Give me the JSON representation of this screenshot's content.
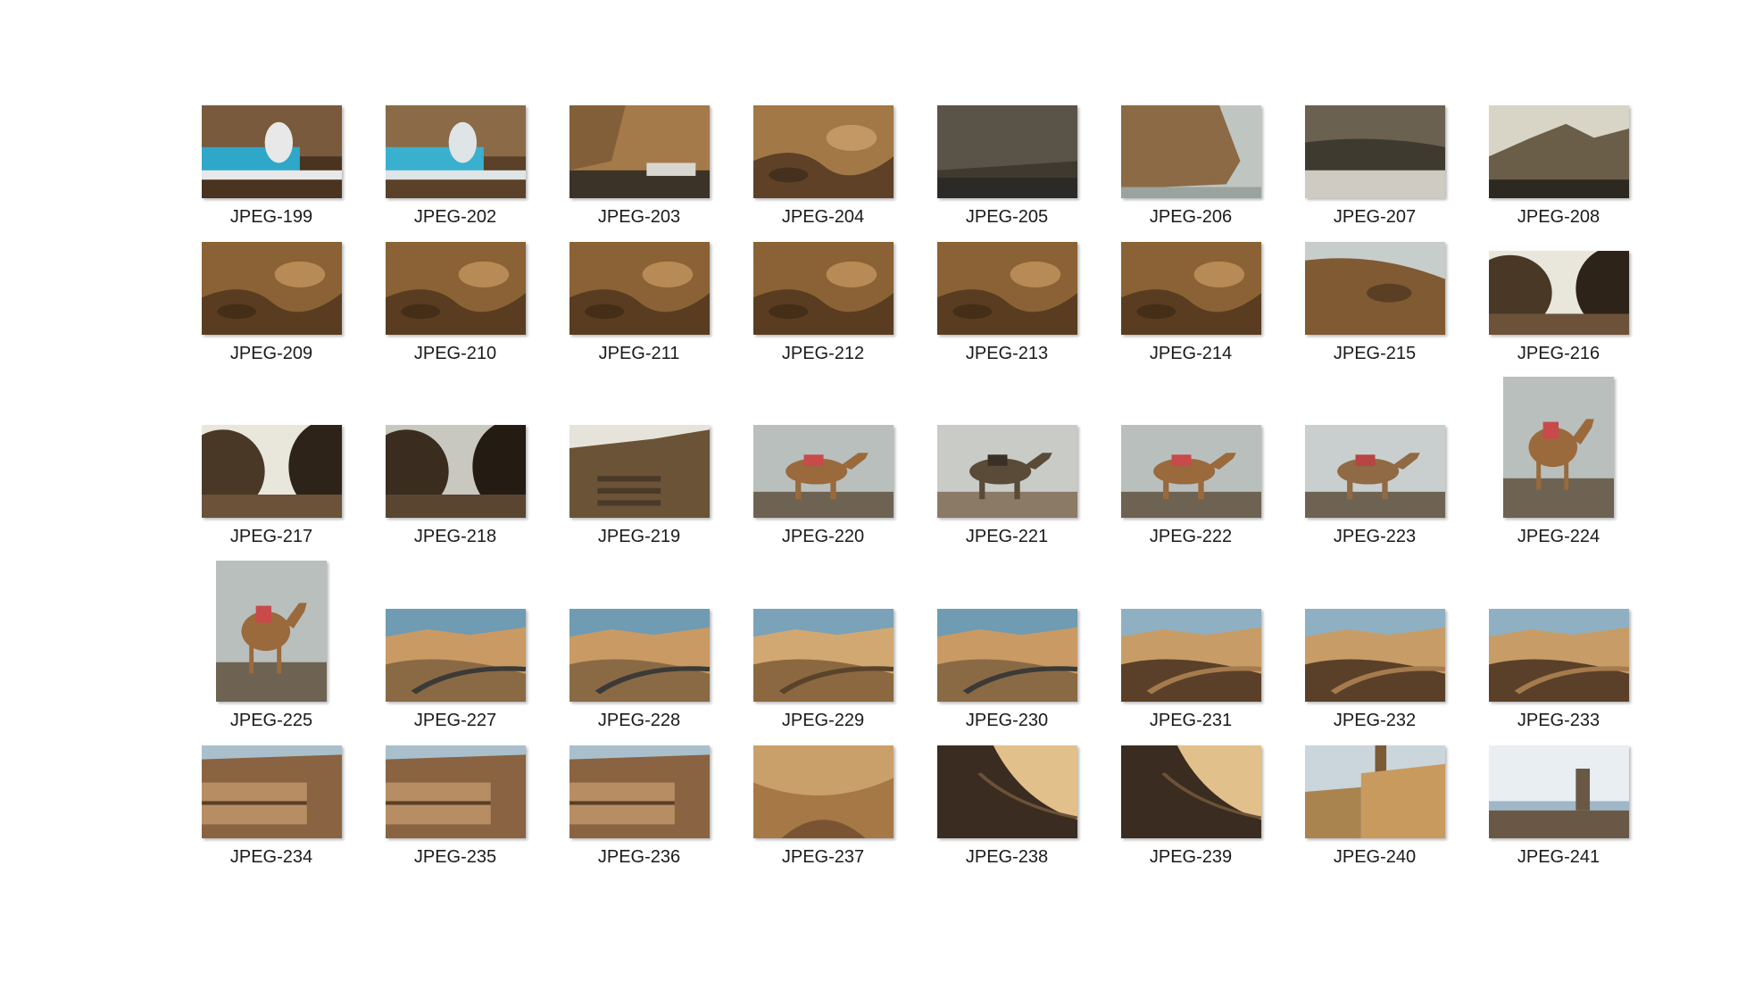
{
  "window": {
    "view_mode": "large-icons"
  },
  "files": [
    {
      "label": "JPEG-199",
      "kind": "boat-person",
      "orientation": "landscape"
    },
    {
      "label": "JPEG-202",
      "kind": "boat",
      "orientation": "landscape"
    },
    {
      "label": "JPEG-203",
      "kind": "cliff-boat",
      "orientation": "landscape"
    },
    {
      "label": "JPEG-204",
      "kind": "cliff",
      "orientation": "landscape"
    },
    {
      "label": "JPEG-205",
      "kind": "haze-sea",
      "orientation": "landscape"
    },
    {
      "label": "JPEG-206",
      "kind": "cliff-sea",
      "orientation": "landscape"
    },
    {
      "label": "JPEG-207",
      "kind": "shore-sparkle",
      "orientation": "landscape"
    },
    {
      "label": "JPEG-208",
      "kind": "mountain-haze",
      "orientation": "landscape"
    },
    {
      "label": "JPEG-209",
      "kind": "rocks",
      "orientation": "landscape"
    },
    {
      "label": "JPEG-210",
      "kind": "rocks",
      "orientation": "landscape"
    },
    {
      "label": "JPEG-211",
      "kind": "rocks",
      "orientation": "landscape"
    },
    {
      "label": "JPEG-212",
      "kind": "rocks",
      "orientation": "landscape"
    },
    {
      "label": "JPEG-213",
      "kind": "rocks",
      "orientation": "landscape"
    },
    {
      "label": "JPEG-214",
      "kind": "rocks",
      "orientation": "landscape"
    },
    {
      "label": "JPEG-215",
      "kind": "rocks-sky",
      "orientation": "landscape"
    },
    {
      "label": "JPEG-216",
      "kind": "boulder-gap",
      "orientation": "landscape-short"
    },
    {
      "label": "JPEG-217",
      "kind": "boulder-gap",
      "orientation": "landscape"
    },
    {
      "label": "JPEG-218",
      "kind": "boulder-gap-dark",
      "orientation": "landscape"
    },
    {
      "label": "JPEG-219",
      "kind": "steps",
      "orientation": "landscape"
    },
    {
      "label": "JPEG-220",
      "kind": "camel",
      "orientation": "landscape"
    },
    {
      "label": "JPEG-221",
      "kind": "camel-close",
      "orientation": "landscape"
    },
    {
      "label": "JPEG-222",
      "kind": "camel",
      "orientation": "landscape"
    },
    {
      "label": "JPEG-223",
      "kind": "camels",
      "orientation": "landscape"
    },
    {
      "label": "JPEG-224",
      "kind": "camel",
      "orientation": "portrait"
    },
    {
      "label": "JPEG-225",
      "kind": "camel",
      "orientation": "portrait"
    },
    {
      "label": "JPEG-227",
      "kind": "desert-road",
      "orientation": "landscape"
    },
    {
      "label": "JPEG-228",
      "kind": "desert-road",
      "orientation": "landscape"
    },
    {
      "label": "JPEG-229",
      "kind": "desert-peak",
      "orientation": "landscape"
    },
    {
      "label": "JPEG-230",
      "kind": "desert-road",
      "orientation": "landscape"
    },
    {
      "label": "JPEG-231",
      "kind": "desert-ridge",
      "orientation": "landscape"
    },
    {
      "label": "JPEG-232",
      "kind": "desert-ridge",
      "orientation": "landscape"
    },
    {
      "label": "JPEG-233",
      "kind": "desert-ridge",
      "orientation": "landscape"
    },
    {
      "label": "JPEG-234",
      "kind": "rock-ledge",
      "orientation": "landscape"
    },
    {
      "label": "JPEG-235",
      "kind": "rock-ledge",
      "orientation": "landscape"
    },
    {
      "label": "JPEG-236",
      "kind": "rock-ledge",
      "orientation": "landscape"
    },
    {
      "label": "JPEG-237",
      "kind": "canyon",
      "orientation": "landscape"
    },
    {
      "label": "JPEG-238",
      "kind": "shadow-slope",
      "orientation": "landscape"
    },
    {
      "label": "JPEG-239",
      "kind": "shadow-slope",
      "orientation": "landscape"
    },
    {
      "label": "JPEG-240",
      "kind": "stairs-tower",
      "orientation": "landscape"
    },
    {
      "label": "JPEG-241",
      "kind": "tower-sea",
      "orientation": "landscape"
    }
  ],
  "palettes": {
    "boat-person": [
      "#7a5a3c",
      "#2fa7c9",
      "#e8e8e8",
      "#4a3420"
    ],
    "boat": [
      "#8b6a48",
      "#3ab0cf",
      "#dfe4e6",
      "#5a4128"
    ],
    "cliff-boat": [
      "#a57a4a",
      "#3b3328",
      "#d9d6cf",
      "#6b4c2e"
    ],
    "cliff": [
      "#a27847",
      "#5e4126",
      "#c39864",
      "#3a2a1a"
    ],
    "haze-sea": [
      "#5a5448",
      "#3f3a30",
      "#2b2a26",
      "#74705f"
    ],
    "cliff-sea": [
      "#8c6a45",
      "#bfc6c2",
      "#5b4329",
      "#9aa39e"
    ],
    "shore-sparkle": [
      "#6b6150",
      "#3f3a2f",
      "#e8e6df",
      "#8d8470"
    ],
    "mountain-haze": [
      "#d8d4c6",
      "#6a5e48",
      "#4a4232",
      "#2d2820"
    ],
    "rocks": [
      "#8a6236",
      "#5a3d20",
      "#b88a55",
      "#3a2814"
    ],
    "rocks-sky": [
      "#7f5a33",
      "#c7cdca",
      "#5a3f24",
      "#a67b4c"
    ],
    "boulder-gap": [
      "#4a3826",
      "#e9e6dc",
      "#2e2318",
      "#6b5238"
    ],
    "boulder-gap-dark": [
      "#3a2c1e",
      "#c9c8c0",
      "#241b12",
      "#5a4530"
    ],
    "steps": [
      "#6b5338",
      "#e6e3da",
      "#4a3a28",
      "#8a6e4e"
    ],
    "camel": [
      "#b9bfbd",
      "#9a6a3c",
      "#6e6352",
      "#c84a4a"
    ],
    "camel-close": [
      "#c8cbc6",
      "#5a4a38",
      "#8b7a66",
      "#3a3026"
    ],
    "camels": [
      "#c9cfcf",
      "#8f6a44",
      "#6e6352",
      "#b84444"
    ],
    "desert-road": [
      "#6f9bb3",
      "#c99a63",
      "#8a6a45",
      "#3b3a38"
    ],
    "desert-peak": [
      "#7aa2b8",
      "#d1a871",
      "#8c6840",
      "#5a432b"
    ],
    "desert-ridge": [
      "#8fb0c2",
      "#c79c66",
      "#5a4028",
      "#a57b4d"
    ],
    "rock-ledge": [
      "#a9c0cc",
      "#8a6342",
      "#5a3f27",
      "#b78e63"
    ],
    "canyon": [
      "#caa06a",
      "#a67846",
      "#7a5432",
      "#e0c08e"
    ],
    "shadow-slope": [
      "#e2c08c",
      "#3a2c20",
      "#6b5238",
      "#c9a270"
    ],
    "stairs-tower": [
      "#cbd6dc",
      "#c89a5e",
      "#7b5a35",
      "#a9844f"
    ],
    "tower-sea": [
      "#e9eef2",
      "#9fb7c7",
      "#6a5846",
      "#b6b8b6"
    ]
  }
}
